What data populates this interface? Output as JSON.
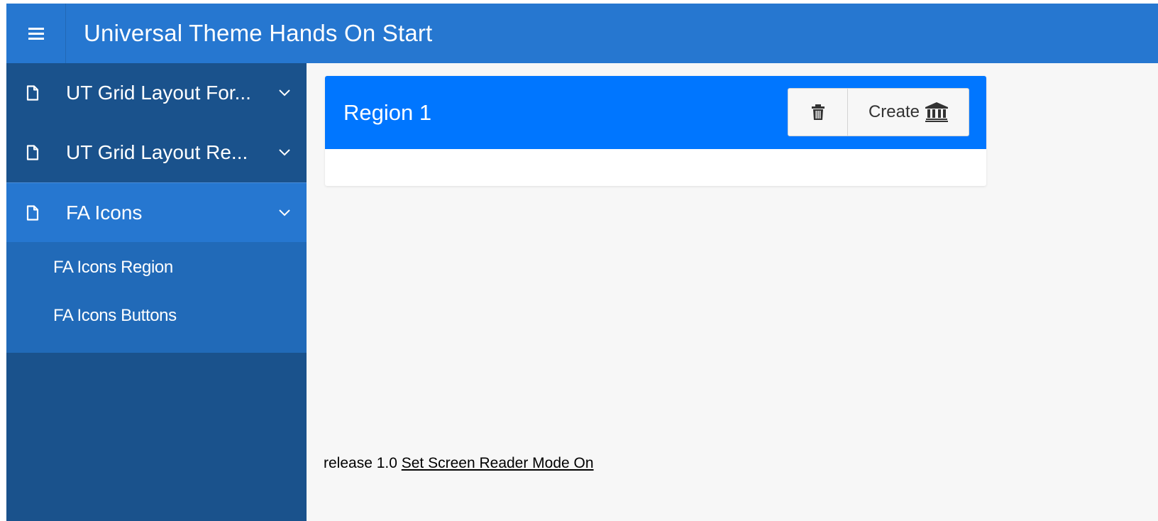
{
  "app": {
    "title": "Universal Theme Hands On Start"
  },
  "sidebar": {
    "items": [
      {
        "label": "UT Grid Layout For...",
        "icon": "file-icon",
        "expand_icon": "chevron-down-icon"
      },
      {
        "label": "UT Grid Layout Re...",
        "icon": "file-icon",
        "expand_icon": "chevron-down-icon"
      },
      {
        "label": "FA Icons",
        "icon": "file-icon",
        "expand_icon": "chevron-down-icon",
        "expanded": true,
        "children": [
          {
            "label": "FA Icons Region"
          },
          {
            "label": "FA Icons Buttons"
          }
        ]
      }
    ]
  },
  "region": {
    "title": "Region 1",
    "buttons": {
      "delete_icon": "trash-icon",
      "create_label": "Create",
      "create_icon": "bank-icon"
    }
  },
  "footer": {
    "release": "release 1.0",
    "screen_reader_link": "Set Screen Reader Mode On"
  },
  "colors": {
    "header": "#2677d0",
    "sidebar": "#1a528c",
    "sidebar_active": "#2677d0",
    "submenu": "#216ab8",
    "region_header": "#0076ff",
    "page_bg": "#f7f7f7"
  }
}
